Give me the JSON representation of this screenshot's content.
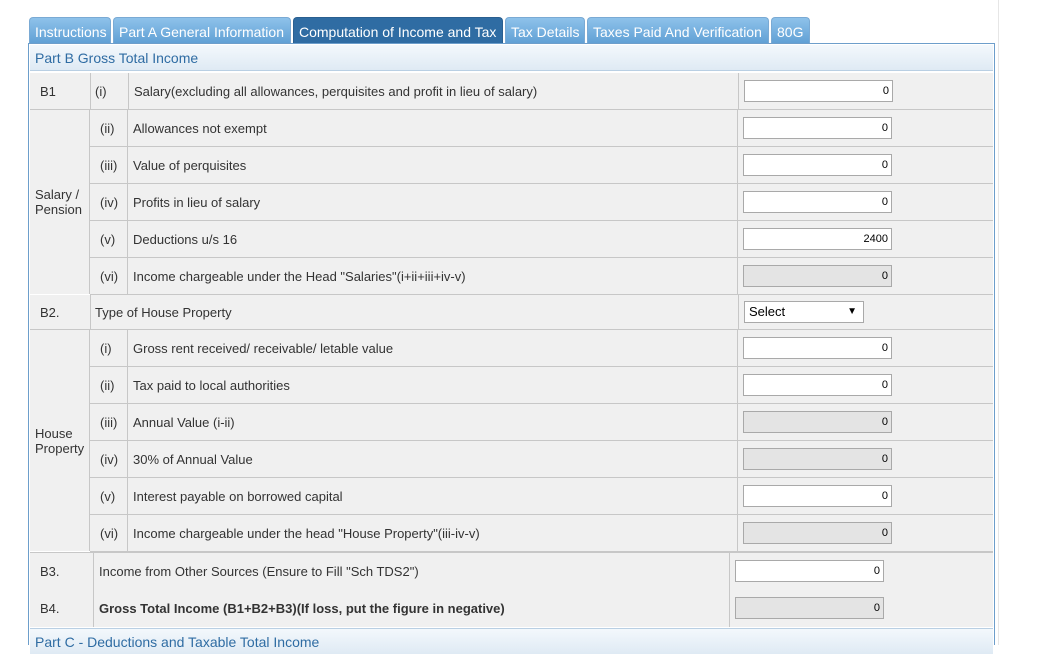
{
  "tabs": [
    {
      "label": "Instructions"
    },
    {
      "label": "Part A General Information"
    },
    {
      "label": "Computation of Income and Tax",
      "active": true
    },
    {
      "label": "Tax Details"
    },
    {
      "label": "Taxes Paid And Verification"
    },
    {
      "label": "80G"
    }
  ],
  "section_b_title": "Part B Gross Total Income",
  "section_c_title": "Part C - Deductions and Taxable Total Income",
  "b1": {
    "code": "B1",
    "group_label_line1": "Salary /",
    "group_label_line2": "Pension",
    "items": [
      {
        "roman": "(i)",
        "label": "Salary(excluding all allowances, perquisites and profit in lieu of salary)",
        "value": "0"
      },
      {
        "roman": "(ii)",
        "label": "Allowances not exempt",
        "value": "0"
      },
      {
        "roman": "(iii)",
        "label": "Value of perquisites",
        "value": "0"
      },
      {
        "roman": "(iv)",
        "label": "Profits in lieu of salary",
        "value": "0"
      },
      {
        "roman": "(v)",
        "label": "Deductions u/s 16",
        "value": "2400"
      },
      {
        "roman": "(vi)",
        "label": "Income chargeable under the Head \"Salaries\"(i+ii+iii+iv-v)",
        "value": "0"
      }
    ]
  },
  "b2": {
    "code": "B2.",
    "type_label": "Type of House Property",
    "select_value": "Select",
    "group_label_line1": "House",
    "group_label_line2": "Property",
    "items": [
      {
        "roman": "(i)",
        "label": "Gross rent received/ receivable/ letable value",
        "value": "0"
      },
      {
        "roman": "(ii)",
        "label": "Tax paid to local authorities",
        "value": "0"
      },
      {
        "roman": "(iii)",
        "label": "Annual Value (i-ii)",
        "value": "0"
      },
      {
        "roman": "(iv)",
        "label": "30% of Annual Value",
        "value": "0"
      },
      {
        "roman": "(v)",
        "label": "Interest payable on borrowed capital",
        "value": "0"
      },
      {
        "roman": "(vi)",
        "label": "Income chargeable under the head \"House Property\"(iii-iv-v)",
        "value": "0"
      }
    ]
  },
  "b3": {
    "code": "B3.",
    "label": "Income from Other Sources (Ensure to Fill \"Sch TDS2\")",
    "value": "0"
  },
  "b4": {
    "code": "B4.",
    "label": "Gross Total Income (B1+B2+B3)(If loss, put the figure in negative)",
    "value": "0"
  }
}
